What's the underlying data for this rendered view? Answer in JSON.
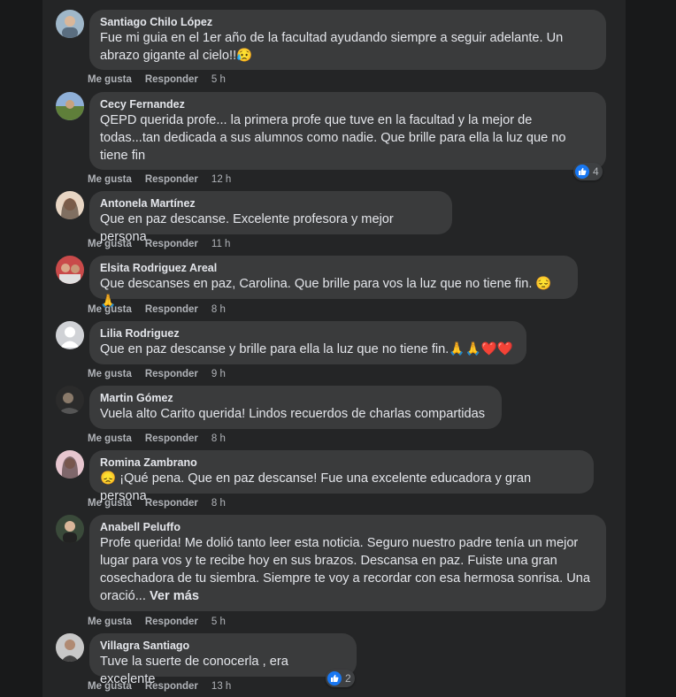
{
  "comments": [
    {
      "author": "Santiago Chilo López",
      "text": "Fue mi guia en el 1er año de la facultad ayudando siempre a seguir adelante. Un abrazo gigante al cielo!!😥",
      "like": "Me gusta",
      "reply": "Responder",
      "time": "5 h"
    },
    {
      "author": "Cecy Fernandez",
      "text": "QEPD querida profe... la primera profe que tuve en la facultad y la mejor de todas...tan dedicada a sus alumnos como nadie. Que brille para ella la luz que no tiene fin",
      "like": "Me gusta",
      "reply": "Responder",
      "time": "12 h",
      "reactions": "4"
    },
    {
      "author": "Antonela Martínez",
      "text": "Que en paz descanse. Excelente profesora y mejor persona",
      "like": "Me gusta",
      "reply": "Responder",
      "time": "11 h"
    },
    {
      "author": "Elsita Rodriguez Areal",
      "text": "Que descanses en paz, Carolina. Que brille para vos la luz que no tiene fin. 😔🙏",
      "like": "Me gusta",
      "reply": "Responder",
      "time": "8 h"
    },
    {
      "author": "Lilia Rodriguez",
      "text": "Que en paz descanse y brille para ella la luz que no tiene fin.🙏🙏❤️❤️",
      "like": "Me gusta",
      "reply": "Responder",
      "time": "9 h"
    },
    {
      "author": "Martin Gómez",
      "text": "Vuela alto Carito querida! Lindos recuerdos de charlas compartidas",
      "like": "Me gusta",
      "reply": "Responder",
      "time": "8 h"
    },
    {
      "author": "Romina Zambrano",
      "text": "😞 ¡Qué pena. Que en paz descanse! Fue una excelente educadora y gran persona.",
      "like": "Me gusta",
      "reply": "Responder",
      "time": "8 h"
    },
    {
      "author": "Anabell Peluffo",
      "text": "Profe querida! Me dolió tanto leer esta noticia. Seguro nuestro padre tenía un mejor lugar para vos y te recibe hoy en sus brazos. Descansa en paz. Fuiste una gran cosechadora de tu siembra. Siempre te voy a recordar con esa hermosa sonrisa. Una oració...",
      "see_more": "Ver más",
      "like": "Me gusta",
      "reply": "Responder",
      "time": "5 h"
    },
    {
      "author": "Villagra Santiago",
      "text": "Tuve la suerte de conocerla , era excelente",
      "like": "Me gusta",
      "reply": "Responder",
      "time": "13 h",
      "reactions": "2"
    }
  ],
  "icons": {
    "reaction": "thumbs-up-icon"
  },
  "colors": {
    "page_bg": "#18191a",
    "panel_bg": "#242526",
    "bubble_bg": "#3a3b3c",
    "text": "#e4e6eb",
    "muted": "#b0b3b8",
    "like_blue": "#1877f2"
  }
}
